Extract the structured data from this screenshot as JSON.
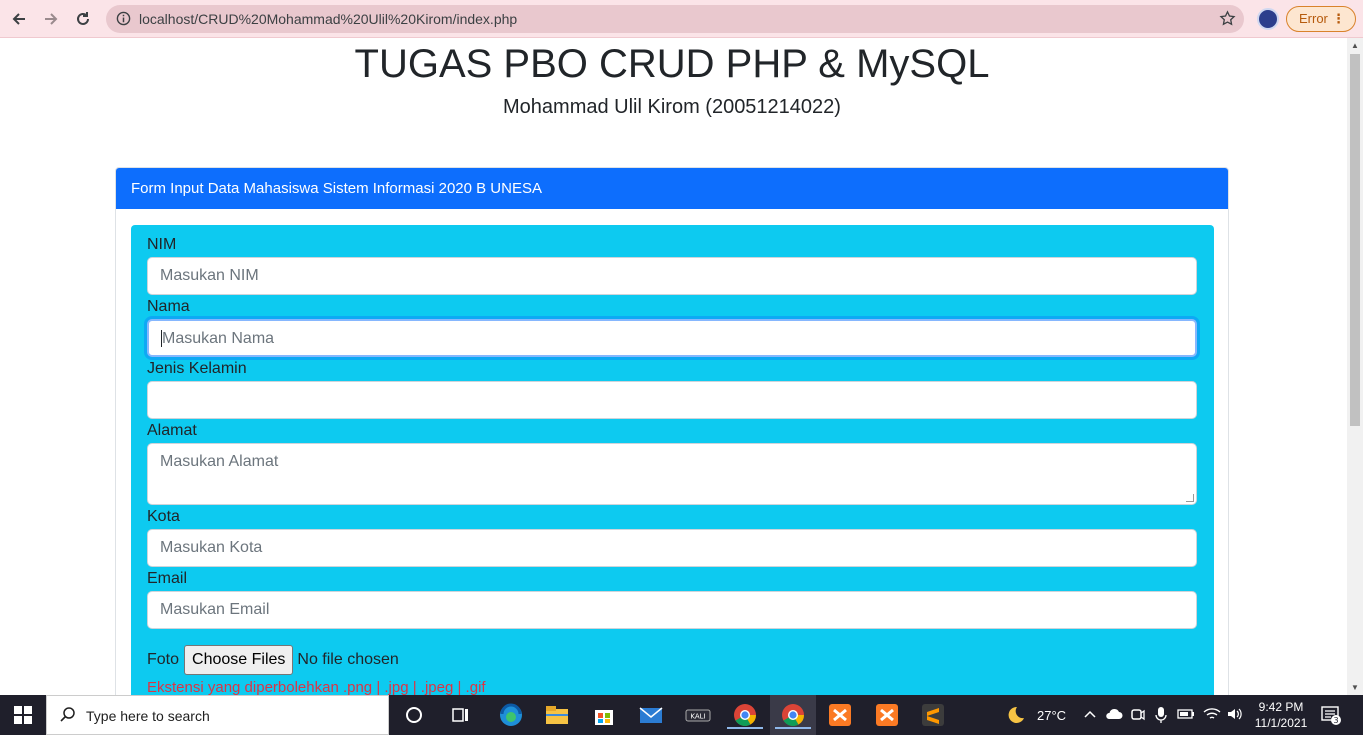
{
  "browser": {
    "url": "localhost/CRUD%20Mohammad%20Ulil%20Kirom/index.php",
    "error_label": "Error"
  },
  "page": {
    "title": "TUGAS PBO CRUD PHP & MySQL",
    "subtitle": "Mohammad Ulil Kirom (20051214022)"
  },
  "card": {
    "header": "Form Input Data Mahasiswa Sistem Informasi 2020 B UNESA"
  },
  "form": {
    "nim": {
      "label": "NIM",
      "placeholder": "Masukan NIM"
    },
    "nama": {
      "label": "Nama",
      "placeholder": "Masukan Nama"
    },
    "jenis_kelamin": {
      "label": "Jenis Kelamin",
      "value": ""
    },
    "alamat": {
      "label": "Alamat",
      "placeholder": "Masukan Alamat"
    },
    "kota": {
      "label": "Kota",
      "placeholder": "Masukan Kota"
    },
    "email": {
      "label": "Email",
      "placeholder": "Masukan Email"
    },
    "foto": {
      "label": "Foto",
      "button": "Choose Files",
      "status": "No file chosen"
    },
    "ext_note": "Ekstensi yang diperbolehkan .png | .jpg | .jpeg | .gif"
  },
  "taskbar": {
    "search_placeholder": "Type here to search",
    "temperature": "27°C",
    "time": "9:42 PM",
    "date": "11/1/2021",
    "notification_count": "3",
    "kali_label": "KALI"
  },
  "colors": {
    "primary": "#0d6efd",
    "info": "#0dcaf0",
    "danger": "#dc3545"
  }
}
